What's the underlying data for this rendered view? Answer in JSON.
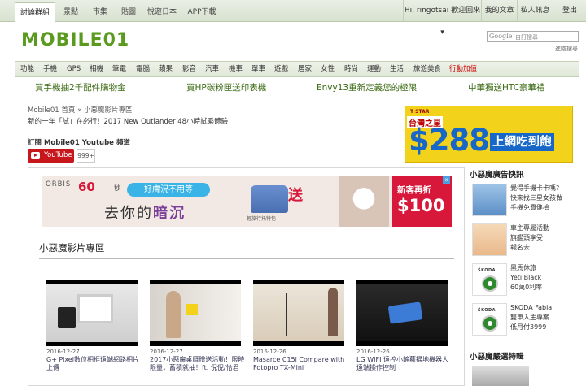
{
  "topbar": {
    "tabs": [
      "討論群組",
      "景點",
      "市集",
      "貼圖",
      "悅遊日本",
      "APP下載"
    ],
    "greeting": "Hi, ringotsai 歡迎回來",
    "links": [
      "我的文章",
      "私人訊息",
      "登出"
    ]
  },
  "header": {
    "logo": "MOBILE01",
    "search_brand": "Google",
    "search_placeholder": "自訂搜尋",
    "advanced_search": "進階搜尋"
  },
  "nav": {
    "items": [
      "功能",
      "手機",
      "GPS",
      "相機",
      "筆電",
      "電腦",
      "蘋果",
      "影音",
      "汽車",
      "機車",
      "單車",
      "遊戲",
      "居家",
      "女性",
      "時尚",
      "運動",
      "生活",
      "旅遊美食",
      "行動加值"
    ]
  },
  "promos": [
    "買手機抽2千配件購物金",
    "買HP碳粉匣送印表機",
    "Envy13重新定義您的極限",
    "中華獨送HTC豪華禮"
  ],
  "breadcrumb": {
    "site": "Mobile01",
    "home": "首頁",
    "sep": "»",
    "current": "小惡魔影片專區"
  },
  "news_headline": "新的一年「試」在必行！2017 New Outlander 48小時試乘體驗",
  "subscribe": {
    "label": "訂閱 Mobile01 Youtube 頻道",
    "button": "YouTube",
    "count": "999+"
  },
  "ad_right": {
    "brand_small": "T STAR",
    "brand": "台灣之星",
    "price": "$288",
    "tagline": "上網吃到飽"
  },
  "ad_banner": {
    "brand": "ORBIS",
    "sixty": "60",
    "sec": "秒",
    "pill": "好膚況不用等",
    "slogan_a": "去你的",
    "slogan_b": "暗沉",
    "send": "送",
    "bag_note": "輕旅行托特包",
    "new_customer": "新客再折",
    "discount": "$100",
    "close": "x"
  },
  "section": {
    "title": "小惡魔影片專區"
  },
  "videos": [
    {
      "date": "2016-12-27",
      "title": "G+ Pixel數位相框遠端網路相片上傳"
    },
    {
      "date": "2016-12-27",
      "title": "2017小惡魔桌曆贈送活動！限時限量，蓄積就抽！ft. 倪倪/恰君"
    },
    {
      "date": "2016-12-26",
      "title": "Masarce C15i Compare with Fotopro TX-Mini"
    },
    {
      "date": "2016-12-26",
      "title": "LG WIFI 遠控小鏟蘿掃地機器人遠端操作控制"
    }
  ],
  "sidebar": {
    "ad_heading": "小惡魔廣告快訊",
    "ads": [
      {
        "lines": [
          "覺得手機卡卡嗎?",
          "快來找三星女孩做",
          "手機免費健檢"
        ]
      },
      {
        "lines": [
          "車主專屬活動",
          "旗艦頭享受",
          "報名去"
        ]
      },
      {
        "lines": [
          "黑馬休旅",
          "Yeti Black",
          "60萬0利率"
        ],
        "logo": "ŠKODA"
      },
      {
        "lines": [
          "SKODA Fabia",
          "雙車入主專案",
          "低月付3999"
        ],
        "logo": "ŠKODA"
      }
    ],
    "promo_heading": "小惡魔嚴選特輯"
  }
}
